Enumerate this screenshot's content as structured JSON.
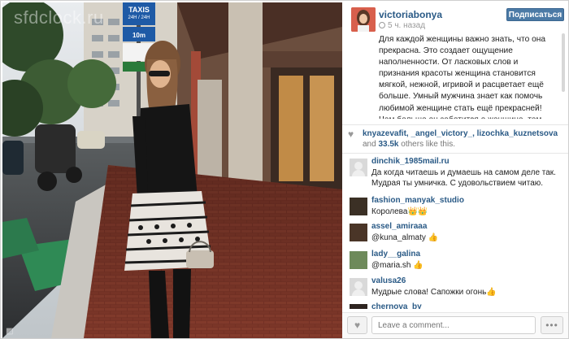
{
  "photo": {
    "watermark": "sfdclock.ru",
    "sign_taxis": "TAXIS",
    "sign_hours": "24H / 24H",
    "sign_distance": "10m",
    "corner_mark": "◩"
  },
  "post": {
    "username": "victoriabonya",
    "time_ago": "5 ч. назад",
    "follow_label": "Подписаться",
    "caption": "Для каждой женщины важно знать, что она прекрасна. Это создает ощущение наполненности. От ласковых слов и признания красоты женщина становится мягкой, нежной, игривой и расцветает ещё больше. Умный мужчина знает как помочь любимой женщине стать ещё прекрасней! Чем больше он заботится о женщине, тем пышнее она цветет и наполняет"
  },
  "likes": {
    "likers": "knyazevafit, _angel_victory_, lizochka_kuznetsova",
    "and_label": "and",
    "count": "33.5k",
    "others_label": "others like this."
  },
  "comments": [
    {
      "user": "dinchik_1985mail.ru",
      "text": "Да когда читаешь и думаешь на самом деле так. Мудрая ты умничка. С удовольствием читаю.",
      "avatar": "blank"
    },
    {
      "user": "fashion_manyak_studio",
      "text": "Королева👑👑",
      "avatar": "photo"
    },
    {
      "user": "assel_amiraaa",
      "text": "@kuna_almaty 👍",
      "avatar": "photo"
    },
    {
      "user": "lady__galina",
      "text": "@maria.sh 👍",
      "avatar": "photo"
    },
    {
      "user": "valusa26",
      "text": "Мудрые слова! Сапожки огонь👍",
      "avatar": "blank"
    },
    {
      "user": "chernova_by",
      "text": "",
      "avatar": "photo"
    }
  ],
  "footer": {
    "comment_placeholder": "Leave a comment...",
    "like_icon": "heart-icon",
    "more_icon": "more-icon"
  },
  "colors": {
    "link": "#2a5a86",
    "follow_button": "#4b7aa6"
  }
}
